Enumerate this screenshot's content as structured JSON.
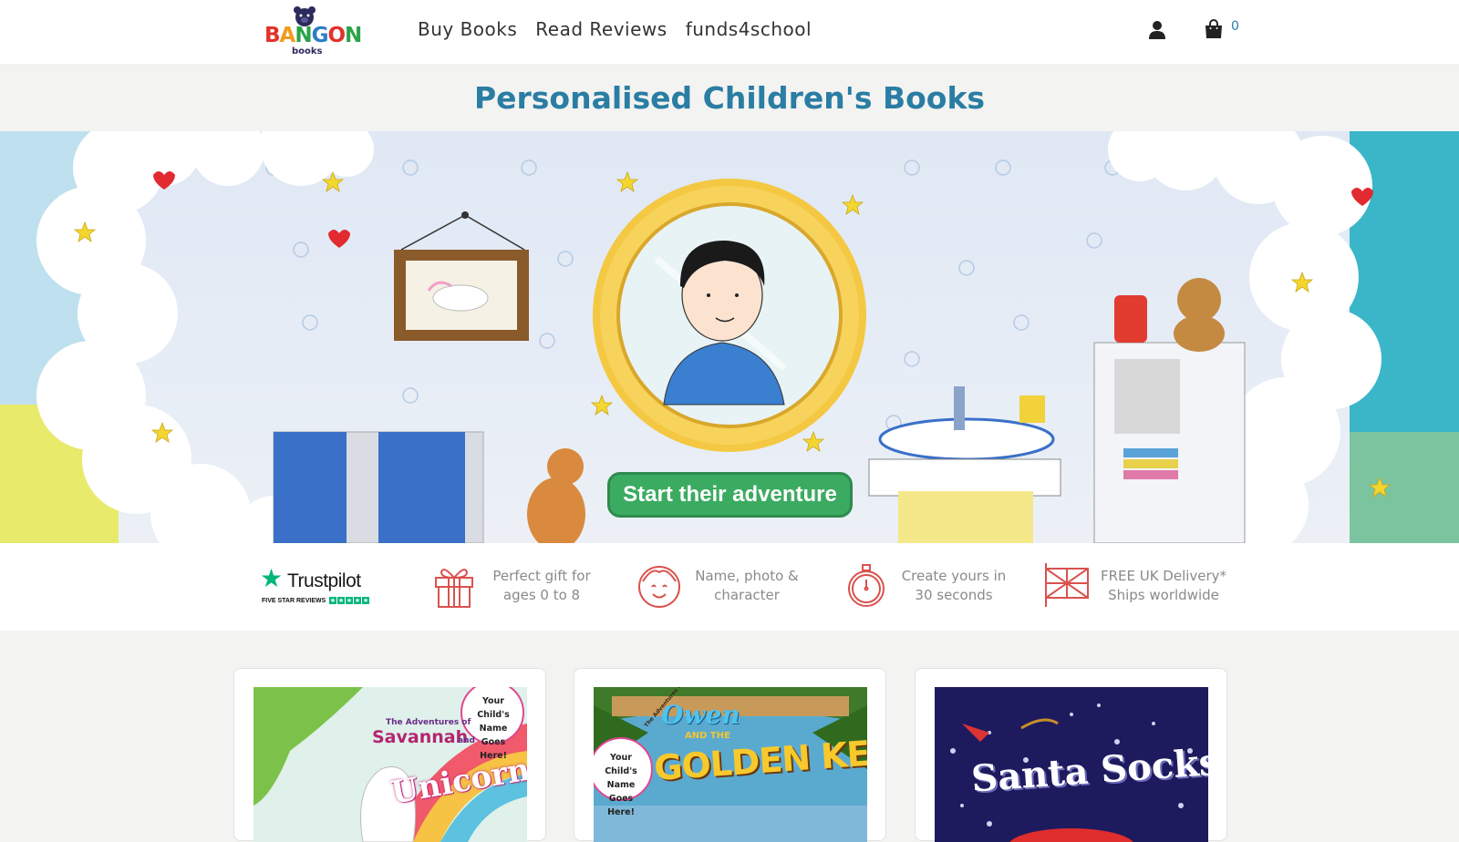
{
  "header": {
    "logo_text": "BANGON",
    "logo_sub": "books",
    "nav": [
      "Buy Books",
      "Read Reviews",
      "funds4school"
    ],
    "cart_count": "0"
  },
  "title": "Personalised Children's Books",
  "hero": {
    "cta_label": "Start their adventure"
  },
  "features": {
    "trustpilot": {
      "name": "Trustpilot",
      "reviews": "FIVE STAR REVIEWS"
    },
    "items": [
      {
        "icon": "gift-icon",
        "line1": "Perfect gift for",
        "line2": "ages 0 to 8"
      },
      {
        "icon": "child-face-icon",
        "line1": "Name, photo &",
        "line2": "character"
      },
      {
        "icon": "stopwatch-icon",
        "line1": "Create yours in",
        "line2": "30 seconds"
      },
      {
        "icon": "uk-flag-icon",
        "line1": "FREE UK Delivery*",
        "line2": "Ships worldwide"
      }
    ]
  },
  "books": [
    {
      "title_top": "The Adventures of",
      "title_name": "Savannah",
      "title_and": "and",
      "title_main": "Unicorn Oo",
      "badge": [
        "Your Child's",
        "Name Goes",
        "Here!"
      ]
    },
    {
      "title_top": "The Adventures of",
      "title_name": "Owen",
      "title_and": "AND THE",
      "title_main": "GOLDEN KEY",
      "badge": [
        "Your Child's",
        "Name Goes",
        "Here!"
      ]
    },
    {
      "title_main": "Santa Socks"
    }
  ],
  "colors": {
    "accent_blue": "#2a7da3",
    "cta_green": "#3bab61",
    "trustpilot_green": "#00b67a",
    "feature_icon": "#d9534f"
  }
}
